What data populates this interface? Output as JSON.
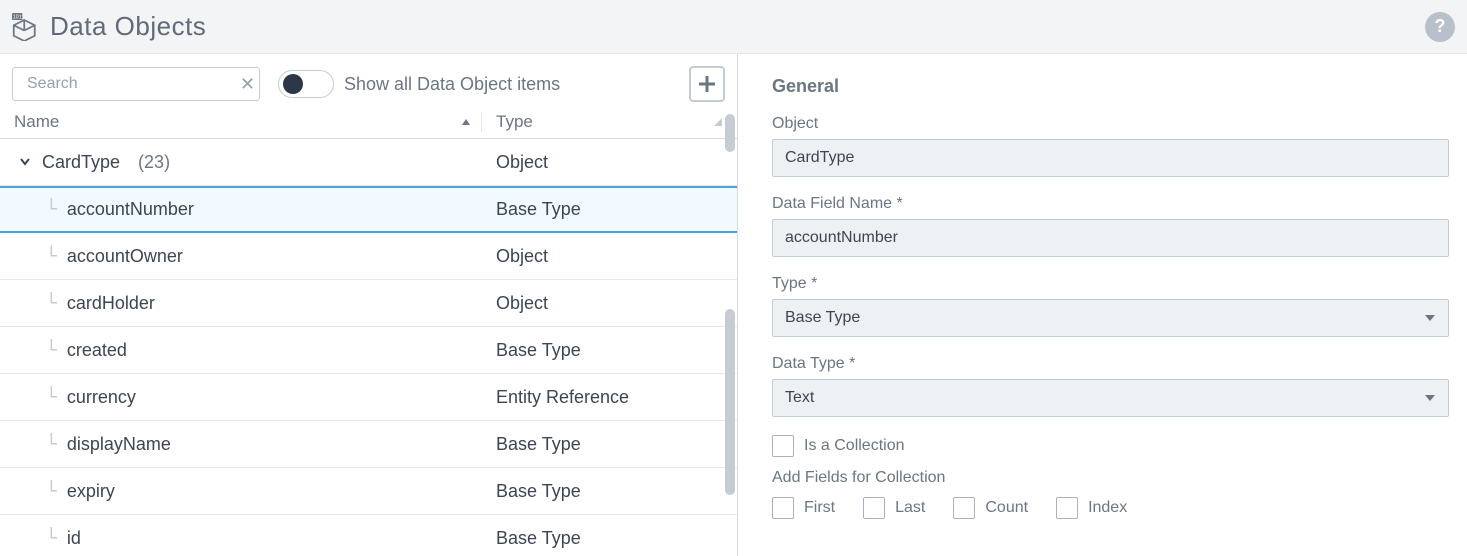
{
  "header": {
    "title": "Data Objects"
  },
  "toolbar": {
    "search_placeholder": "Search",
    "toggle_label": "Show all Data Object items"
  },
  "columns": {
    "name": "Name",
    "type": "Type"
  },
  "tree": {
    "parent": {
      "name": "CardType",
      "count": "(23)",
      "type": "Object"
    },
    "rows": [
      {
        "name": "accountNumber",
        "type": "Base Type",
        "selected": true
      },
      {
        "name": "accountOwner",
        "type": "Object",
        "selected": false
      },
      {
        "name": "cardHolder",
        "type": "Object",
        "selected": false
      },
      {
        "name": "created",
        "type": "Base Type",
        "selected": false
      },
      {
        "name": "currency",
        "type": "Entity Reference",
        "selected": false
      },
      {
        "name": "displayName",
        "type": "Base Type",
        "selected": false
      },
      {
        "name": "expiry",
        "type": "Base Type",
        "selected": false
      },
      {
        "name": "id",
        "type": "Base Type",
        "selected": false
      }
    ]
  },
  "details": {
    "section": "General",
    "labels": {
      "object": "Object",
      "field_name": "Data Field Name *",
      "type": "Type *",
      "data_type": "Data Type *",
      "is_collection": "Is a Collection",
      "add_fields": "Add Fields for Collection",
      "first": "First",
      "last": "Last",
      "count": "Count",
      "index": "Index"
    },
    "values": {
      "object": "CardType",
      "field_name": "accountNumber",
      "type": "Base Type",
      "data_type": "Text"
    }
  }
}
